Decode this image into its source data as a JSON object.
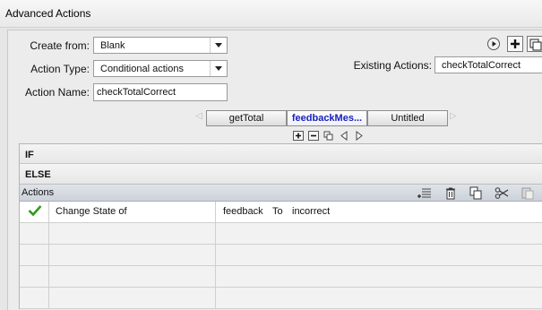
{
  "window": {
    "title": "Advanced Actions"
  },
  "form": {
    "create_from": {
      "label": "Create from:",
      "value": "Blank"
    },
    "action_type": {
      "label": "Action Type:",
      "value": "Conditional actions"
    },
    "action_name": {
      "label": "Action Name:",
      "value": "checkTotalCorrect"
    },
    "existing_actions": {
      "label": "Existing Actions:",
      "value": "checkTotalCorrect"
    }
  },
  "tabs": [
    {
      "label": "getTotal",
      "active": false
    },
    {
      "label": "feedbackMes...",
      "active": true
    },
    {
      "label": "Untitled",
      "active": false
    }
  ],
  "conditions": {
    "if_label": "IF",
    "else_label": "ELSE"
  },
  "actions_panel": {
    "title": "Actions",
    "toolbar_icons": [
      "insert-row-icon",
      "trash-icon",
      "copy-icon",
      "cut-icon",
      "paste-icon"
    ],
    "rows": [
      {
        "checked": true,
        "action": "Change State of",
        "target": "feedback",
        "connector": "To",
        "state": "incorrect"
      }
    ]
  },
  "colors": {
    "accent": "#1a22b5",
    "check": "#2f9a1c"
  }
}
